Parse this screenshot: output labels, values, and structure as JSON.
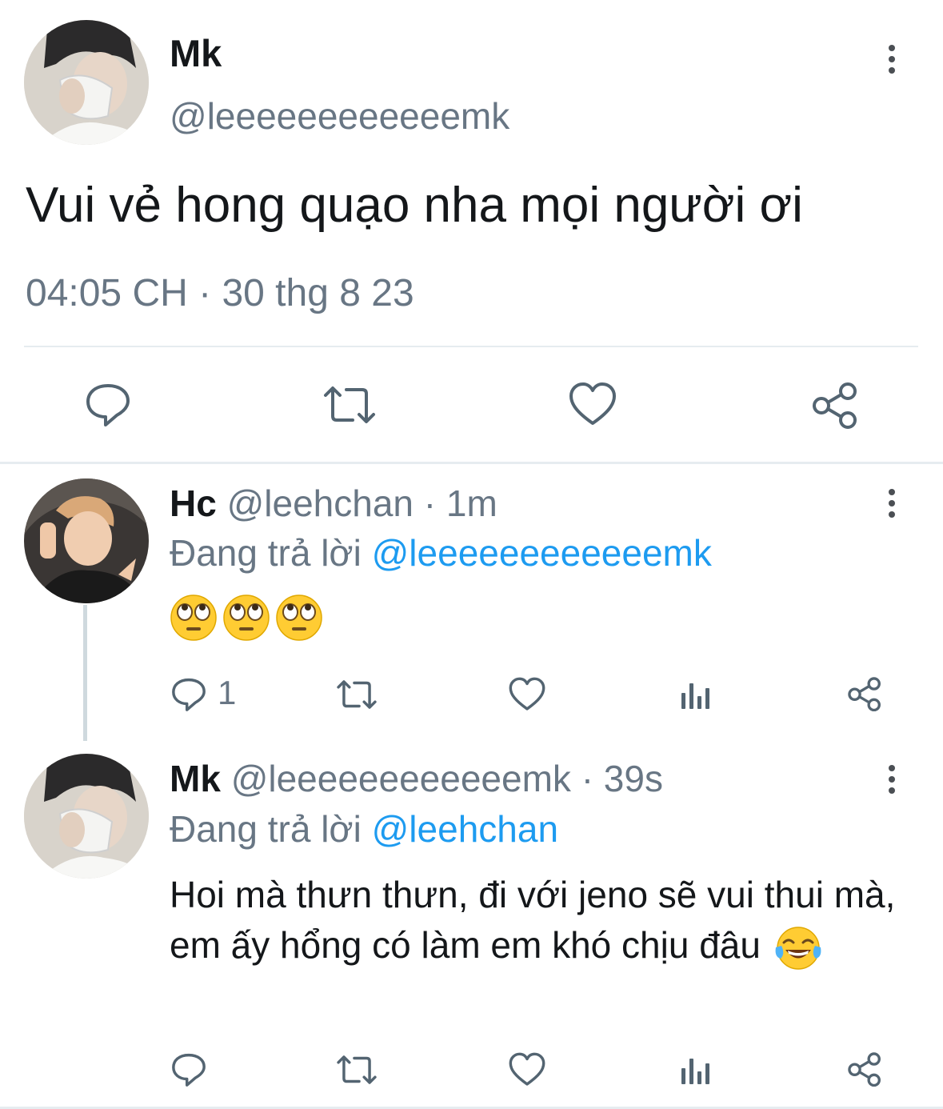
{
  "main_tweet": {
    "display_name": "Mk",
    "handle": "@leeeeeeeeeeeemk",
    "text": "Vui vẻ hong quạo nha mọi người ơi",
    "timestamp": "04:05 CH · 30 thg 8 23"
  },
  "replies": [
    {
      "display_name": "Hc",
      "handle_time": "@leehchan · 1m",
      "replying_prefix": "Đang trả lời ",
      "replying_to": "@leeeeeeeeeeeemk",
      "emoji_names": [
        "face-with-rolling-eyes",
        "face-with-rolling-eyes",
        "face-with-rolling-eyes"
      ],
      "reply_count": "1"
    },
    {
      "display_name": "Mk",
      "handle_time": "@leeeeeeeeeeeemk · 39s",
      "replying_prefix": "Đang trả lời ",
      "replying_to": "@leehchan",
      "text": "Hoi mà thưn thưn, đi với jeno sẽ vui thui mà, em ấy hổng có làm em khó chịu đâu",
      "emoji_names": [
        "face-with-tears-of-joy"
      ]
    }
  ],
  "colors": {
    "text": "#14171a",
    "secondary": "#687684",
    "link": "#1d9bf0",
    "divider": "#e6ecf0"
  },
  "icons": [
    "reply-icon",
    "retweet-icon",
    "like-icon",
    "share-icon",
    "analytics-icon",
    "more-icon"
  ]
}
